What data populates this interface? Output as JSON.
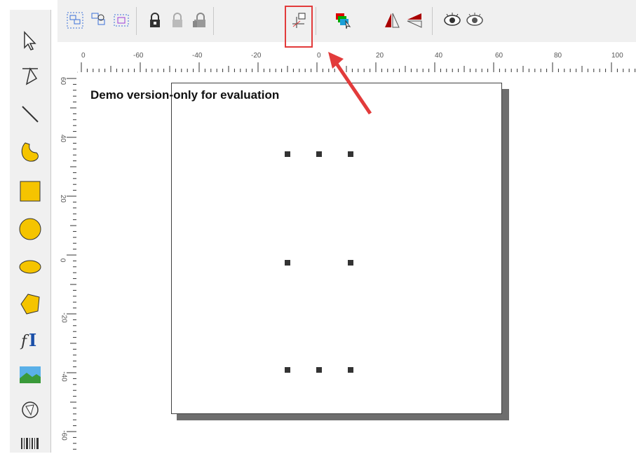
{
  "canvas": {
    "demo_notice": "Demo version-only for evaluation"
  },
  "ruler": {
    "horizontal_labels": [
      "0",
      "-60",
      "-40",
      "-20",
      "0",
      "20",
      "40",
      "60",
      "80",
      "100"
    ],
    "vertical_labels": [
      "60",
      "40",
      "20",
      "0",
      "-20",
      "-40",
      "-60"
    ]
  },
  "toolbar": {
    "buttons": [
      "group-objects",
      "ungroup-objects",
      "select-group",
      "lock",
      "lock-disabled",
      "lock-all",
      "set-origin",
      "layers",
      "mirror-horizontal",
      "mirror-vertical",
      "show-all",
      "hide"
    ],
    "highlighted": "set-origin"
  },
  "toolbox": [
    "select",
    "node-edit",
    "line",
    "freehand",
    "rectangle",
    "circle",
    "ellipse",
    "polygon",
    "text",
    "image",
    "rotate",
    "barcode"
  ],
  "colors": {
    "highlight": "#e23b3b",
    "shape_fill": "#f5c400",
    "handle": "#333333"
  }
}
